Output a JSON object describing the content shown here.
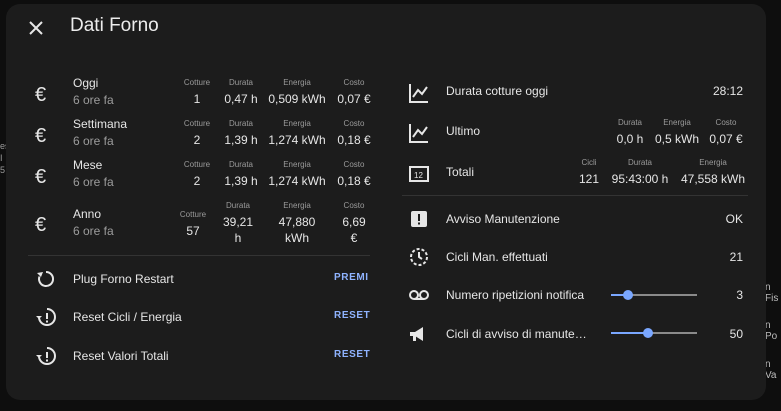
{
  "dialog": {
    "title": "Dati Forno"
  },
  "background": {
    "left_fragments": [
      "es",
      "I",
      "5"
    ],
    "right_fragments": [
      "n Fis",
      "n Po",
      "n Va"
    ]
  },
  "left": {
    "periods": [
      {
        "name": "Oggi",
        "sub": "6 ore fa",
        "cols": [
          {
            "h": "Cotture",
            "v": "1"
          },
          {
            "h": "Durata",
            "v": "0,47 h"
          },
          {
            "h": "Energia",
            "v": "0,509 kWh"
          },
          {
            "h": "Costo",
            "v": "0,07 €"
          }
        ]
      },
      {
        "name": "Settimana",
        "sub": "6 ore fa",
        "cols": [
          {
            "h": "Cotture",
            "v": "2"
          },
          {
            "h": "Durata",
            "v": "1,39 h"
          },
          {
            "h": "Energia",
            "v": "1,274 kWh"
          },
          {
            "h": "Costo",
            "v": "0,18 €"
          }
        ]
      },
      {
        "name": "Mese",
        "sub": "6 ore fa",
        "cols": [
          {
            "h": "Cotture",
            "v": "2"
          },
          {
            "h": "Durata",
            "v": "1,39 h"
          },
          {
            "h": "Energia",
            "v": "1,274 kWh"
          },
          {
            "h": "Costo",
            "v": "0,18 €"
          }
        ]
      },
      {
        "name": "Anno",
        "sub": "6 ore fa",
        "cols": [
          {
            "h": "Cotture",
            "v": "57"
          },
          {
            "h": "Durata",
            "v1": "39,21",
            "v2": "h"
          },
          {
            "h": "Energia",
            "v1": "47,880",
            "v2": "kWh"
          },
          {
            "h": "Costo",
            "v1": "6,69",
            "v2": "€"
          }
        ]
      }
    ],
    "buttons": [
      {
        "name": "Plug Forno Restart",
        "action": "PREMI",
        "icon": "restart-icon"
      },
      {
        "name": "Reset Cicli / Energia",
        "action": "RESET",
        "icon": "history-alert-icon"
      },
      {
        "name": "Reset Valori Totali",
        "action": "RESET",
        "icon": "history-alert-icon"
      }
    ]
  },
  "right": {
    "durata_oggi": {
      "name": "Durata cotture oggi",
      "value": "28:12",
      "icon": "chart-line-icon"
    },
    "ultimo": {
      "name": "Ultimo",
      "icon": "chart-line-icon",
      "cols": [
        {
          "h": "Durata",
          "v": "0,0 h"
        },
        {
          "h": "Energia",
          "v": "0,5 kWh"
        },
        {
          "h": "Costo",
          "v": "0,07 €"
        }
      ]
    },
    "totali": {
      "name": "Totali",
      "icon": "counter-icon",
      "cols": [
        {
          "h": "Cicli",
          "v": "121"
        },
        {
          "h": "Durata",
          "v": "95:43:00 h"
        },
        {
          "h": "Energia",
          "v": "47,558 kWh"
        }
      ]
    },
    "avviso": {
      "name": "Avviso Manutenzione",
      "value": "OK",
      "icon": "alert-box-icon"
    },
    "cicli_man": {
      "name": "Cicli Man. effettuati",
      "value": "21",
      "icon": "clock-cycle-icon"
    },
    "ripetizioni": {
      "name": "Numero ripetizioni notifica",
      "value": "3",
      "level_fraction": 0.2,
      "icon": "voicemail-icon"
    },
    "cicli_avviso": {
      "name": "Cicli di avviso di manute…",
      "value": "50",
      "level_fraction": 0.43,
      "icon": "megaphone-icon"
    }
  },
  "colors": {
    "accent": "#7aa7ff",
    "button_text": "#8fb3ff",
    "surface": "#1c1c1c"
  }
}
